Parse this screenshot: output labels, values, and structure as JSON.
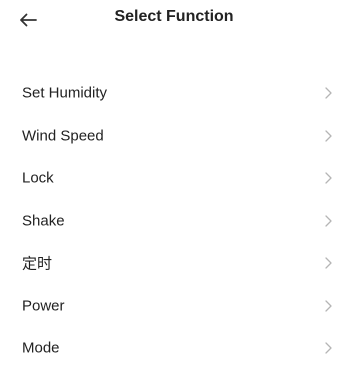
{
  "header": {
    "title": "Select Function",
    "back_icon": "arrow-left-icon"
  },
  "functions": [
    {
      "label": "Set Humidity"
    },
    {
      "label": "Wind Speed"
    },
    {
      "label": "Lock"
    },
    {
      "label": "Shake"
    },
    {
      "label": "定时"
    },
    {
      "label": "Power"
    },
    {
      "label": "Mode"
    }
  ],
  "colors": {
    "text": "#222222",
    "chevron": "#b5b5b5",
    "background": "#ffffff"
  }
}
